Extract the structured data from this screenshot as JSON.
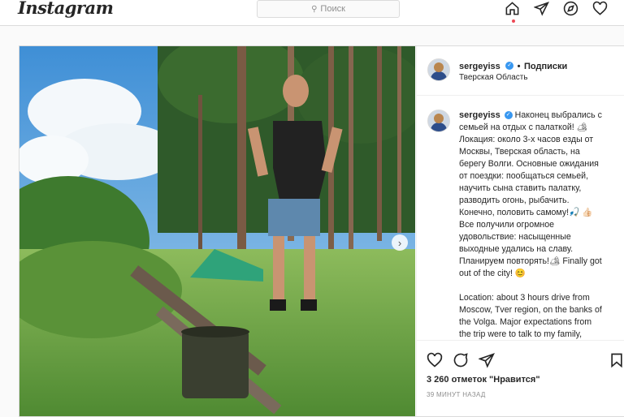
{
  "header": {
    "logo": "Instagram",
    "search_placeholder": "Поиск",
    "nav_icons": [
      "home-icon",
      "direct-icon",
      "explore-icon",
      "activity-icon"
    ]
  },
  "post": {
    "username": "sergeyiss",
    "follow_separator": "•",
    "follow_label": "Подписки",
    "location": "Тверская Область",
    "caption_lines": [
      "Наконец выбрались с",
      "семьей на отдых с палаткой! 🏕",
      "Локация: около 3-х часов  езды от",
      "Москвы, Тверская область, на",
      "берегу Волги. Основные ожидания",
      "от поездки: пообщаться семьей,",
      "научить сына ставить палатку,",
      "разводить огонь, рыбачить.",
      "Конечно, половить самому!🎣 👍🏻",
      "Все получили огромное",
      "удовольствие: насыщенные",
      "выходные удались на славу.",
      "Планируем повторять!🏕 Finally got",
      "out of the city! 😊",
      "",
      "Location: about 3 hours drive from",
      "Moscow, Tver region, on the banks of",
      "the Volga. Major expectations from",
      "the trip were to talk to my family,"
    ],
    "likes": "3 260 отметок \"Нравится\"",
    "timestamp": "39 МИНУТ НАЗАД",
    "carousel_next": "›"
  },
  "colors": {
    "verified": "#3897f0",
    "notification_dot": "#ed4956",
    "border": "#dbdbdb"
  }
}
